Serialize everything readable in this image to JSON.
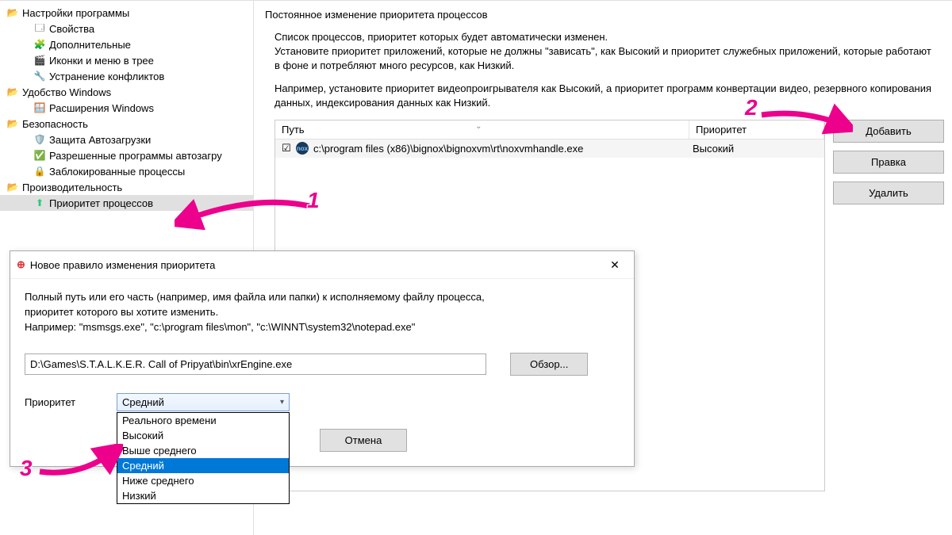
{
  "sidebar": {
    "groups": [
      {
        "label": "Настройки программы",
        "items": [
          {
            "icon": "🗔",
            "label": "Свойства"
          },
          {
            "icon": "🧩",
            "label": "Дополнительные"
          },
          {
            "icon": "🎬",
            "label": "Иконки и меню в трее"
          },
          {
            "icon": "🔧",
            "label": "Устранение конфликтов"
          }
        ]
      },
      {
        "label": "Удобство Windows",
        "items": [
          {
            "icon": "🪟",
            "label": "Расширения Windows"
          }
        ]
      },
      {
        "label": "Безопасность",
        "items": [
          {
            "icon": "🛡️",
            "label": "Защита Автозагрузки"
          },
          {
            "icon": "✅",
            "label": "Разрешенные программы автозагру"
          },
          {
            "icon": "🔒",
            "label": "Заблокированные процессы"
          }
        ]
      },
      {
        "label": "Производительность",
        "items": [
          {
            "icon": "⬆",
            "label": "Приоритет процессов",
            "selected": true
          }
        ]
      }
    ]
  },
  "content": {
    "title": "Постоянное изменение приоритета процессов",
    "desc_p1": "Список процессов, приоритет которых будет автоматически изменен.",
    "desc_p2": "Установите приоритет приложений, которые не должны \"зависать\", как Высокий и приоритет служебных приложений, которые работают в фоне и потребляют много ресурсов, как Низкий.",
    "desc_p3": "Например, установите приоритет видеопроигрывателя как Высокий, а приоритет программ конвертации видео, резервного копирования данных, индексирования данных как Низкий.",
    "table": {
      "col_path": "Путь",
      "col_priority": "Приоритет",
      "rows": [
        {
          "path": "c:\\program files (x86)\\bignox\\bignoxvm\\rt\\noxvmhandle.exe",
          "priority": "Высокий"
        }
      ]
    },
    "buttons": {
      "add": "Добавить",
      "edit": "Правка",
      "delete": "Удалить"
    }
  },
  "dialog": {
    "title": "Новое правило изменения приоритета",
    "desc_l1": "Полный путь или его часть (например, имя файла или папки) к исполняемому файлу процесса,",
    "desc_l2": "приоритет которого вы хотите изменить.",
    "desc_l3": "Например: \"msmsgs.exe\", \"c:\\program files\\mon\", \"c:\\WINNT\\system32\\notepad.exe\"",
    "path_value": "D:\\Games\\S.T.A.L.K.E.R. Call of Pripyat\\bin\\xrEngine.exe",
    "browse": "Обзор...",
    "priority_label": "Приоритет",
    "combo_value": "Средний",
    "options": [
      "Реального времени",
      "Высокий",
      "Выше среднего",
      "Средний",
      "Ниже среднего",
      "Низкий"
    ],
    "highlighted_index": 3,
    "cancel": "Отмена"
  },
  "annotations": {
    "n1": "1",
    "n2": "2",
    "n3": "3"
  }
}
